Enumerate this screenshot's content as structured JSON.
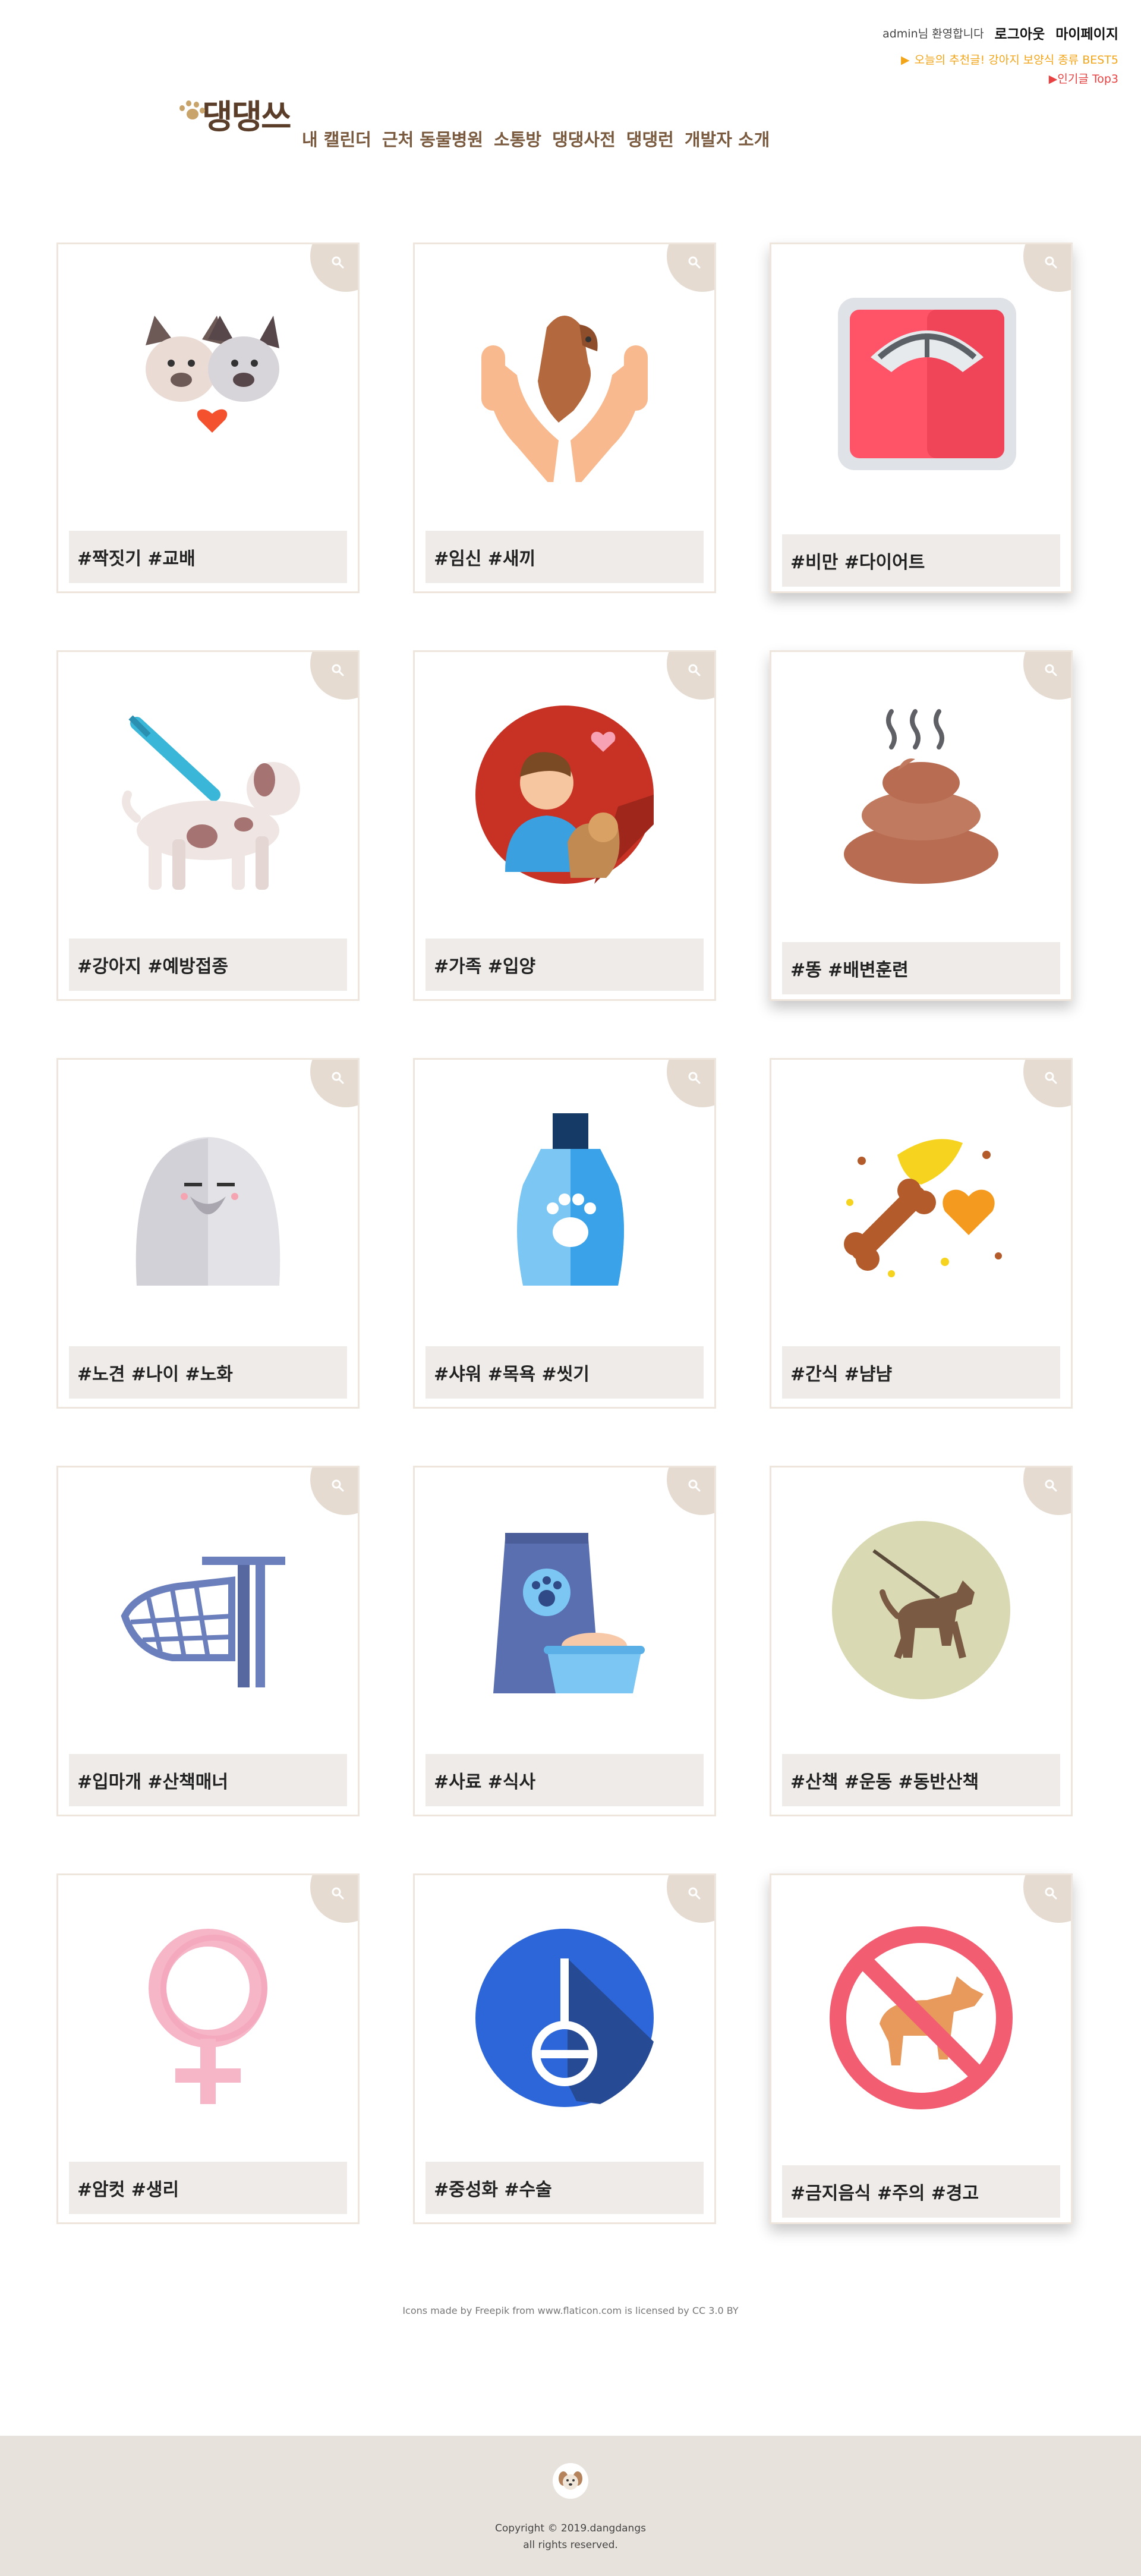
{
  "header": {
    "welcome": "admin님 환영합니다",
    "logout": "로그아웃",
    "mypage": "마이페이지",
    "recommend": "오늘의 추천글! 강아지 보양식 종류 BEST5",
    "recommend_marker": "▶",
    "popular": "▶인기글 Top3",
    "logo": "댕댕쓰",
    "nav": [
      "내 캘린더",
      "근처 동물병원",
      "소통방",
      "댕댕사전",
      "댕댕런",
      "개발자 소개"
    ]
  },
  "cards": [
    {
      "tag": "#짝짓기 #교배",
      "icon": "two-dogs-heart-icon"
    },
    {
      "tag": "#임신 #새끼",
      "icon": "hands-holding-dog-icon"
    },
    {
      "tag": "#비만 #다이어트",
      "icon": "scale-icon"
    },
    {
      "tag": "#강아지 #예방접종",
      "icon": "dog-vaccine-icon"
    },
    {
      "tag": "#가족 #입양",
      "icon": "person-with-dog-icon"
    },
    {
      "tag": "#똥 #배변훈련",
      "icon": "poop-icon"
    },
    {
      "tag": "#노견 #나이 #노화",
      "icon": "old-dog-icon"
    },
    {
      "tag": "#샤워 #목욕 #씻기",
      "icon": "shampoo-icon"
    },
    {
      "tag": "#간식 #냠냠",
      "icon": "treats-icon"
    },
    {
      "tag": "#입마개 #산책매너",
      "icon": "muzzle-icon"
    },
    {
      "tag": "#사료 #식사",
      "icon": "dog-food-icon"
    },
    {
      "tag": "#산책 #운동 #동반산책",
      "icon": "walking-dog-icon"
    },
    {
      "tag": "#암컷 #생리",
      "icon": "female-symbol-icon"
    },
    {
      "tag": "#중성화 #수술",
      "icon": "neuter-symbol-icon"
    },
    {
      "tag": "#금지음식 #주의 #경고",
      "icon": "no-dogs-icon"
    }
  ],
  "credit": "Icons made by Freepik from www.flaticon.com is licensed by CC 3.0 BY",
  "footer": {
    "copyright": "Copyright © 2019.dangdangs",
    "rights": "all rights reserved."
  },
  "colors": {
    "brand_brown": "#7a5a3e",
    "card_border": "#eee5dc",
    "tag_bg": "#eeebe8",
    "recommend": "#f3a51a",
    "popular": "#e84141",
    "footer_bg": "#e8e2dc"
  }
}
